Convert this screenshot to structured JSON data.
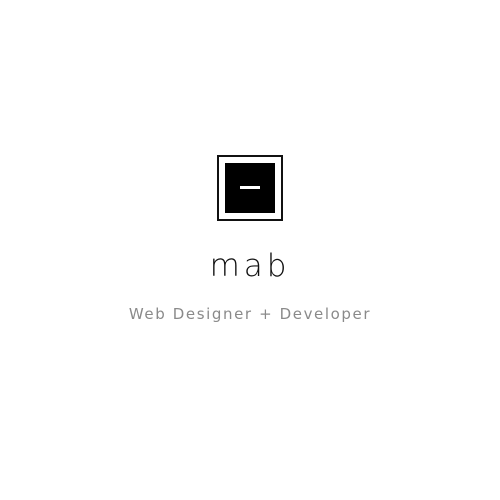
{
  "brand": {
    "logo_icon": "square-minus-logo-icon",
    "name": "mab",
    "tagline": "Web Designer + Developer"
  },
  "colors": {
    "background": "#ffffff",
    "logo": "#000000",
    "name": "#111111",
    "tagline": "#8a8a8a"
  }
}
